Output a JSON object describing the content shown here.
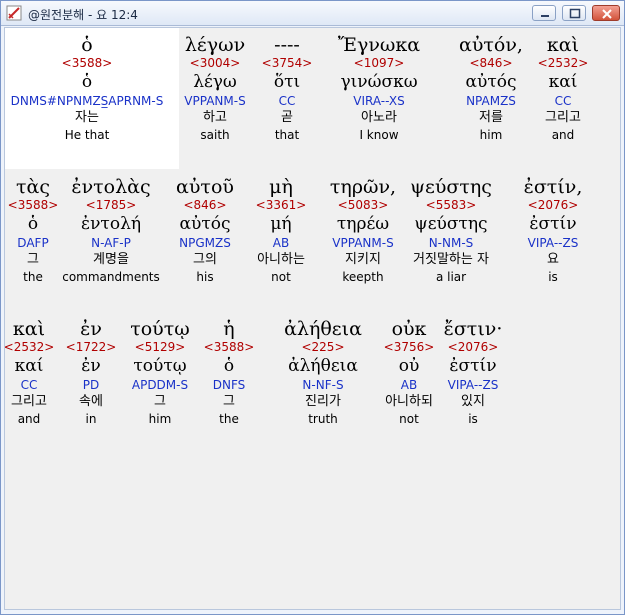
{
  "window": {
    "title": "@원전분해 - 요 12:4"
  },
  "rows": [
    [
      {
        "greek": "ὁ",
        "strong": "<3588>",
        "lemma": "ὁ",
        "parse": "DNMS#NPNMZS̲APRNM-S",
        "kor": "자는",
        "eng": "He that"
      },
      {
        "greek": "λέγων",
        "strong": "<3004>",
        "lemma": "λέγω",
        "parse": "VPPANM-S",
        "kor": "하고",
        "eng": "saith"
      },
      {
        "greek": "----",
        "strong": "<3754>",
        "lemma": "ὅτι",
        "parse": "CC",
        "kor": "곧",
        "eng": "that"
      },
      {
        "greek": "Ἔγνωκα",
        "strong": "<1097>",
        "lemma": "γινώσκω",
        "parse": "VIRA--XS",
        "kor": "아노라",
        "eng": "I know"
      },
      {
        "greek": "αὐτόν,",
        "strong": "<846>",
        "lemma": "αὐτός",
        "parse": "NPAMZS",
        "kor": "저를",
        "eng": "him"
      },
      {
        "greek": "καὶ",
        "strong": "<2532>",
        "lemma": "καί",
        "parse": "CC",
        "kor": "그리고",
        "eng": "and"
      }
    ],
    [
      {
        "greek": "τὰς",
        "strong": "<3588>",
        "lemma": "ὁ",
        "parse": "DAFP",
        "kor": "그",
        "eng": "the"
      },
      {
        "greek": "ἐντολὰς",
        "strong": "<1785>",
        "lemma": "ἐντολή",
        "parse": "N-AF-P",
        "kor": "계명을",
        "eng": "commandments"
      },
      {
        "greek": "αὐτοῦ",
        "strong": "<846>",
        "lemma": "αὐτός",
        "parse": "NPGMZS",
        "kor": "그의",
        "eng": "his"
      },
      {
        "greek": "μὴ",
        "strong": "<3361>",
        "lemma": "μή",
        "parse": "AB",
        "kor": "아니하는",
        "eng": "not"
      },
      {
        "greek": "τηρῶν,",
        "strong": "<5083>",
        "lemma": "τηρέω",
        "parse": "VPPANM-S",
        "kor": "지키지",
        "eng": "keepth"
      },
      {
        "greek": "ψεύστης",
        "strong": "<5583>",
        "lemma": "ψεύστης",
        "parse": "N-NM-S",
        "kor": "거짓말하는 자",
        "eng": "a liar"
      },
      {
        "greek": "ἐστίν,",
        "strong": "<2076>",
        "lemma": "ἐστίν",
        "parse": "VIPA--ZS",
        "kor": "요",
        "eng": "is"
      }
    ],
    [
      {
        "greek": "καὶ",
        "strong": "<2532>",
        "lemma": "καί",
        "parse": "CC",
        "kor": "그리고",
        "eng": "and"
      },
      {
        "greek": "ἐν",
        "strong": "<1722>",
        "lemma": "ἐν",
        "parse": "PD",
        "kor": "속에",
        "eng": "in"
      },
      {
        "greek": "τούτῳ",
        "strong": "<5129>",
        "lemma": "τούτῳ",
        "parse": "APDDM-S",
        "kor": "그",
        "eng": "him"
      },
      {
        "greek": "ἡ",
        "strong": "<3588>",
        "lemma": "ὁ",
        "parse": "DNFS",
        "kor": "그",
        "eng": "the"
      },
      {
        "greek": "ἀλήθεια",
        "strong": "<225>",
        "lemma": "ἀλήθεια",
        "parse": "N-NF-S",
        "kor": "진리가",
        "eng": "truth"
      },
      {
        "greek": "οὐκ",
        "strong": "<3756>",
        "lemma": "οὐ",
        "parse": "AB",
        "kor": "아니하되",
        "eng": "not"
      },
      {
        "greek": "ἔστιν·",
        "strong": "<2076>",
        "lemma": "ἐστίν",
        "parse": "VIPA--ZS",
        "kor": "있지",
        "eng": "is"
      }
    ]
  ]
}
